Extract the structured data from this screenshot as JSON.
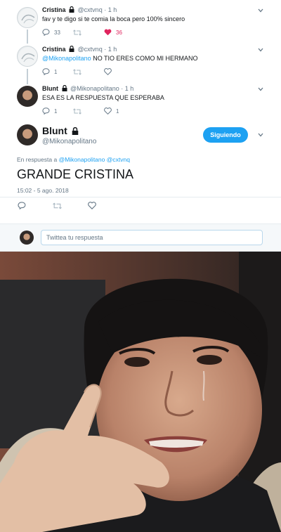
{
  "tweets": [
    {
      "name": "Cristina",
      "handle": "@cxtvnq",
      "time": "1 h",
      "text": "fav y te digo si te comia la boca pero 100% sincero",
      "replies": "33",
      "retweets": "",
      "likes": "36",
      "liked": true
    },
    {
      "name": "Cristina",
      "handle": "@cxtvnq",
      "time": "1 h",
      "mention": "@Mikonapolitano",
      "text": "NO TIO ERES COMO MI HERMANO",
      "replies": "1",
      "retweets": "",
      "likes": ""
    },
    {
      "name": "Blunt",
      "handle": "@Mikonapolitano",
      "time": "1 h",
      "text": "ESA ES LA RESPUESTA QUE ESPERABA",
      "replies": "1",
      "retweets": "",
      "likes": "1"
    }
  ],
  "main_tweet": {
    "name": "Blunt",
    "handle": "@Mikonapolitano",
    "follow_label": "Siguiendo",
    "reply_prefix": "En respuesta a",
    "reply_mention_1": "@Mikonapolitano",
    "reply_mention_2": "@cxtvnq",
    "text": "GRANDE CRISTINA",
    "timestamp": "15:02 - 5 ago. 2018"
  },
  "reply_box": {
    "placeholder": "Twittea tu respuesta"
  },
  "colors": {
    "accent": "#1da1f2",
    "like": "#e0245e",
    "muted": "#657786"
  },
  "icons": [
    "reply-icon",
    "retweet-icon",
    "like-icon",
    "lock-icon",
    "chevron-down-icon"
  ]
}
